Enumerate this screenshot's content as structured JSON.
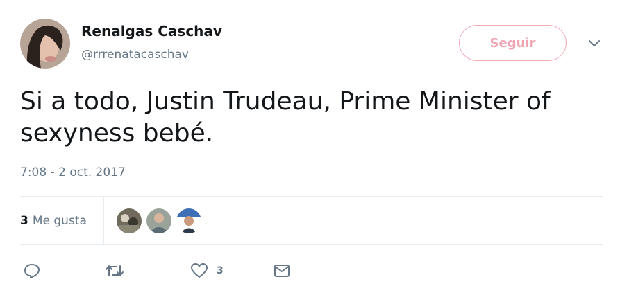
{
  "tweet": {
    "author": {
      "display_name": "Renalgas Caschav",
      "handle": "@rrrenatacaschav"
    },
    "follow_label": "Seguir",
    "text": "Si a todo, Justin Trudeau, Prime Minister of sexyness bebé.",
    "timestamp": "7:08 - 2 oct. 2017",
    "likes": {
      "count": "3",
      "label": "Me gusta"
    },
    "actions": {
      "reply_icon": "reply-icon",
      "retweet_icon": "retweet-icon",
      "like_icon": "heart-icon",
      "like_count": "3",
      "message_icon": "envelope-icon"
    },
    "colors": {
      "follow_border": "#f0aab6",
      "follow_text": "#f0a3b0",
      "icon": "#657786",
      "muted_text": "#657786",
      "divider": "#e6ecf0"
    }
  }
}
